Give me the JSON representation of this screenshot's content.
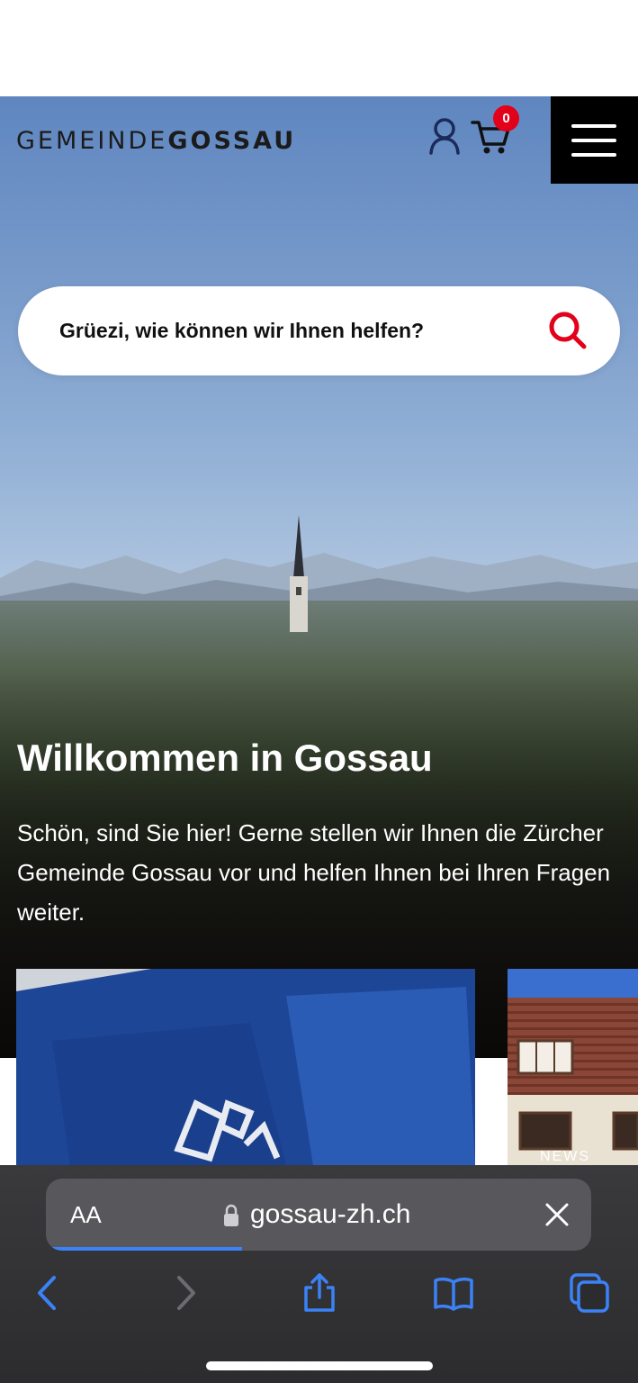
{
  "header": {
    "logo_light": "GEMEINDE",
    "logo_bold": "GOSSAU",
    "cart_count": "0"
  },
  "search": {
    "placeholder": "Grüezi, wie können wir Ihnen helfen?"
  },
  "welcome": {
    "title": "Willkommen in Gossau",
    "text": "Schön, sind Sie hier! Gerne stellen wir Ihnen die Zürcher Gemeinde Gossau vor und helfen Ihnen bei Ihren Fragen weiter."
  },
  "cards": [
    {
      "label": ""
    },
    {
      "label": "NEWS"
    }
  ],
  "browser": {
    "text_size_label": "AA",
    "url": "gossau-zh.ch",
    "load_progress": 0.36
  },
  "colors": {
    "accent_red": "#e2001a",
    "browser_blue": "#3b82f6"
  }
}
